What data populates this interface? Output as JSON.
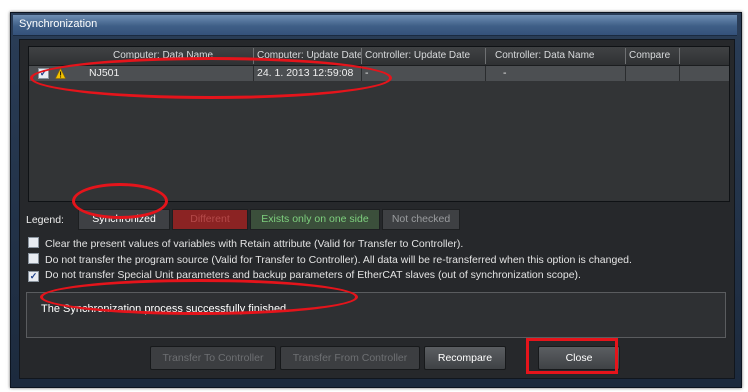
{
  "window": {
    "title": "Synchronization"
  },
  "grid": {
    "columns": [
      "Computer: Data Name",
      "Computer: Update Date",
      "Controller: Update Date",
      "Controller: Data Name",
      "Compare"
    ],
    "rows": [
      {
        "checked": true,
        "status_icon": "warning-icon",
        "computer_data_name": "NJ501",
        "computer_update_date": "24. 1. 2013 12:59:08",
        "controller_update_date": "-",
        "controller_data_name": "-",
        "compare": ""
      }
    ]
  },
  "legend": {
    "label": "Legend:",
    "items": [
      {
        "label": "Synchronized",
        "bg": "#3e4044",
        "fg": "#ffffff"
      },
      {
        "label": "Different",
        "bg": "#8b2323",
        "fg": "#b54a4a"
      },
      {
        "label": "Exists only on one side",
        "bg": "#3b4f3b",
        "fg": "#7ed07e"
      },
      {
        "label": "Not checked",
        "bg": "#3e4043",
        "fg": "#9a9c9f"
      }
    ]
  },
  "options": [
    {
      "checked": false,
      "label": "Clear the present values of variables with Retain attribute (Valid for Transfer to Controller)."
    },
    {
      "checked": false,
      "label": "Do not transfer the program source (Valid for Transfer to Controller). All data will be re-transferred when this option is changed."
    },
    {
      "checked": true,
      "label": "Do not transfer Special Unit parameters and backup parameters of EtherCAT slaves (out of synchronization scope)."
    }
  ],
  "message": "The Synchronization process successfully finished.",
  "buttons": {
    "transfer_to": "Transfer To Controller",
    "transfer_from": "Transfer From Controller",
    "recompare": "Recompare",
    "close": "Close"
  },
  "colors": {
    "annotation": "#e5141b",
    "title_bar": "#4a6a93"
  }
}
